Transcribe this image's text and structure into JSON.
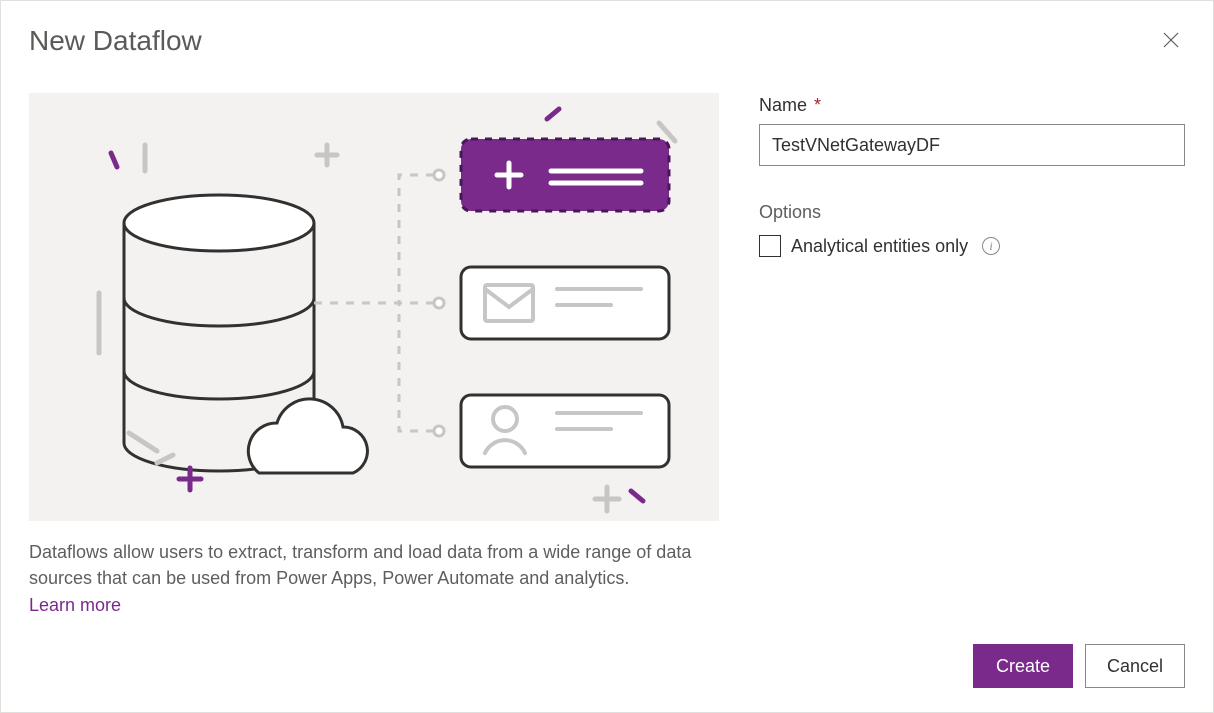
{
  "dialog": {
    "title": "New Dataflow",
    "description": "Dataflows allow users to extract, transform and load data from a wide range of data sources that can be used from Power Apps, Power Automate and analytics.",
    "learn_more_label": "Learn more"
  },
  "form": {
    "name_label": "Name",
    "name_required_marker": "*",
    "name_value": "TestVNetGatewayDF",
    "options_heading": "Options",
    "analytical_checkbox_label": "Analytical entities only",
    "analytical_checked": false
  },
  "footer": {
    "create_label": "Create",
    "cancel_label": "Cancel"
  },
  "colors": {
    "accent": "#7a2a8a",
    "illustration_bg": "#f3f2f1"
  }
}
